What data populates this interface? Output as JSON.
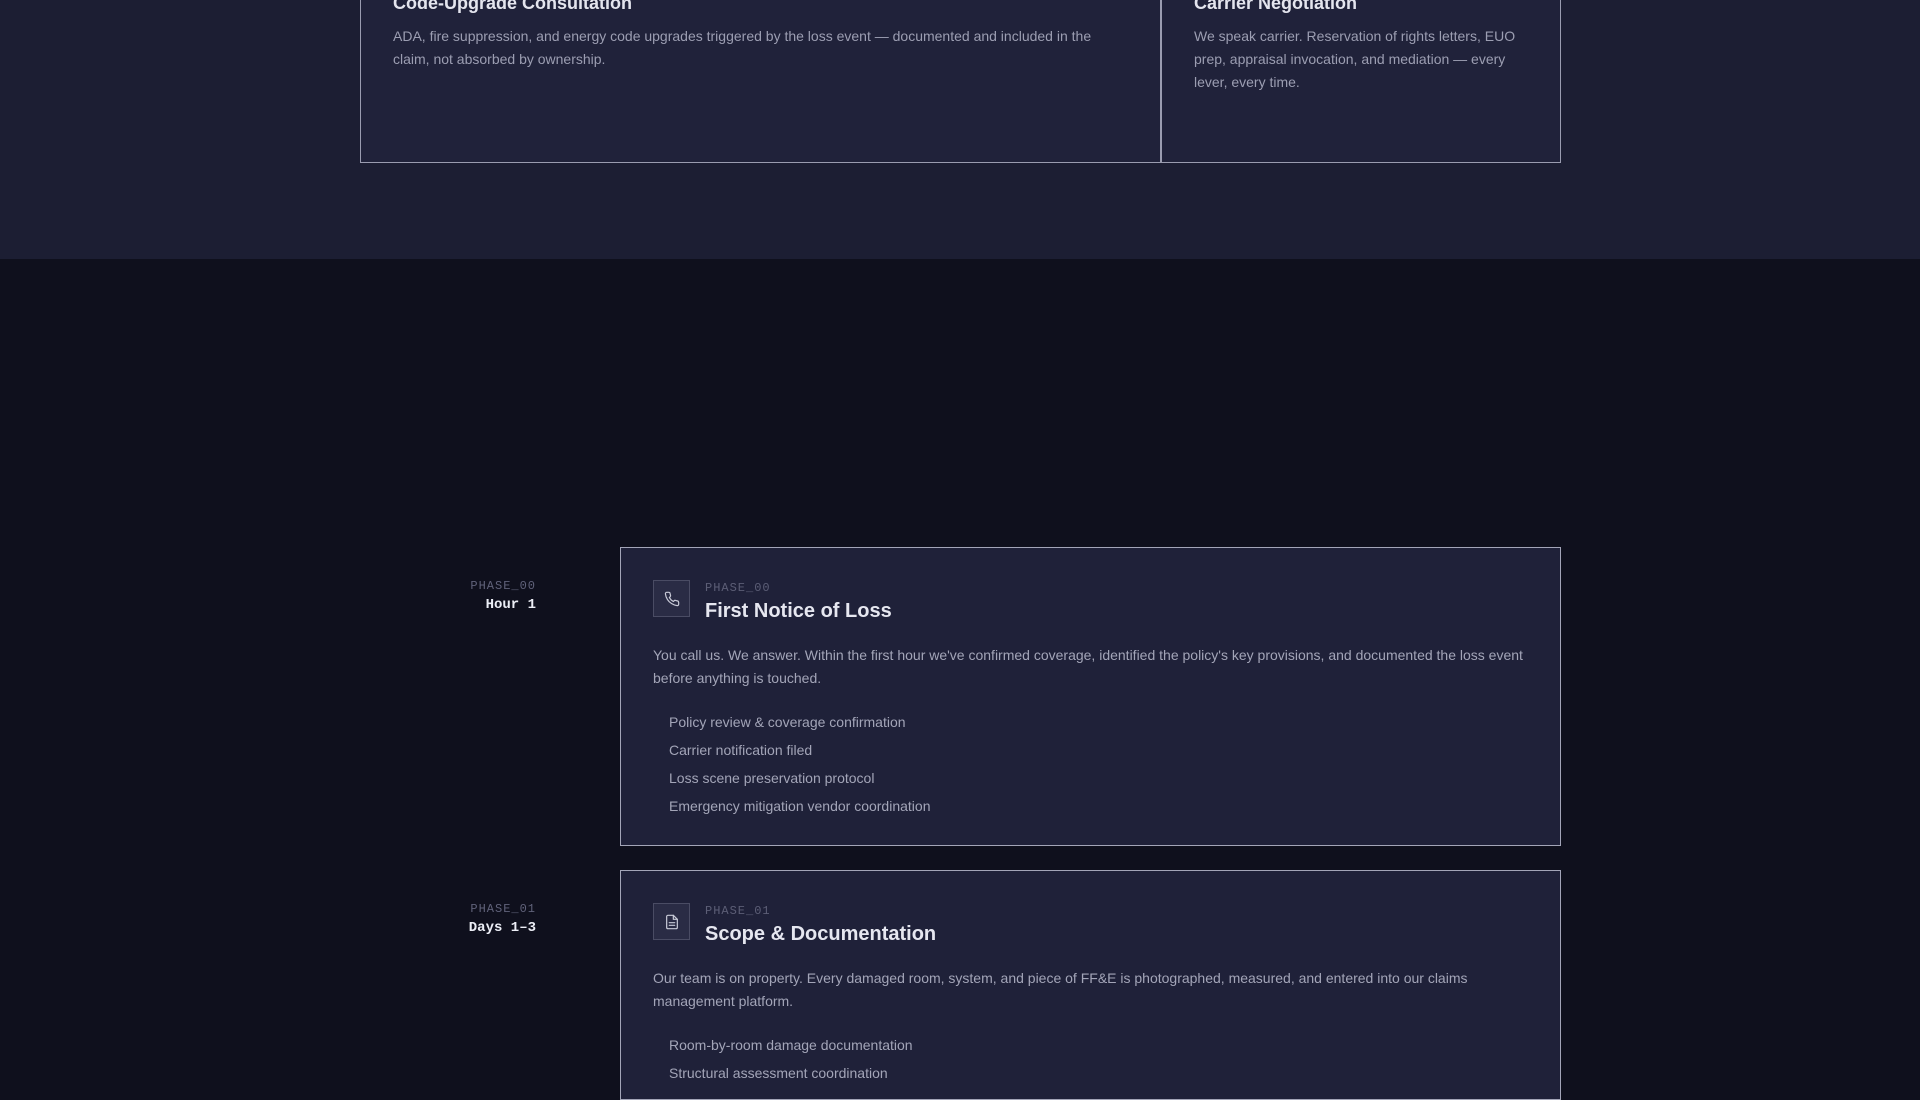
{
  "services": [
    {
      "title": "Code-Upgrade Consultation",
      "description": "ADA, fire suppression, and energy code upgrades triggered by the loss event — documented and included in the claim, not absorbed by ownership."
    },
    {
      "title": "Carrier Negotiation",
      "description": "We speak carrier. Reservation of rights letters, EUO prep, appraisal invocation, and mediation — every lever, every time."
    }
  ],
  "phases": [
    {
      "code": "PHASE_00",
      "timeframe": "Hour 1",
      "icon": "phone-icon",
      "title": "First Notice of Loss",
      "description": "You call us. We answer. Within the first hour we've confirmed coverage, identified the policy's key provisions, and documented the loss event before anything is touched.",
      "items": [
        "Policy review & coverage confirmation",
        "Carrier notification filed",
        "Loss scene preservation protocol",
        "Emergency mitigation vendor coordination"
      ]
    },
    {
      "code": "PHASE_01",
      "timeframe": "Days 1–3",
      "icon": "document-icon",
      "title": "Scope & Documentation",
      "description": "Our team is on property. Every damaged room, system, and piece of FF&E is photographed, measured, and entered into our claims management platform.",
      "items": [
        "Room-by-room damage documentation",
        "Structural assessment coordination"
      ]
    }
  ]
}
